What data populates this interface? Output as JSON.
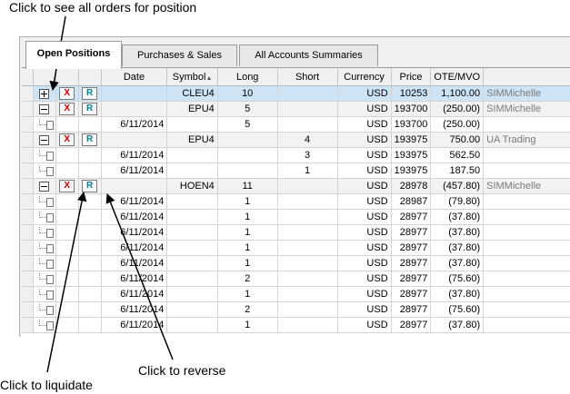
{
  "callouts": {
    "top": "Click to see all orders for position",
    "liquidate": "Click to liquidate",
    "reverse": "Click to reverse"
  },
  "tabs": [
    {
      "label": "Open Positions",
      "active": true
    },
    {
      "label": "Purchases & Sales",
      "active": false
    },
    {
      "label": "All Accounts Summaries",
      "active": false
    }
  ],
  "columns": {
    "date": "Date",
    "symbol": "Symbol",
    "long": "Long",
    "short": "Short",
    "currency": "Currency",
    "price": "Price",
    "ote": "OTE/MVO"
  },
  "buttons": {
    "liquidate": "X",
    "reverse": "R"
  },
  "rows": [
    {
      "kind": "parent",
      "expanded": false,
      "selected": true,
      "date": "",
      "symbol": "CLEU4",
      "long": "10",
      "short": "",
      "currency": "USD",
      "price": "10253",
      "ote": "1,100.00",
      "account": "SIMMichelle"
    },
    {
      "kind": "parent",
      "expanded": true,
      "selected": false,
      "date": "",
      "symbol": "EPU4",
      "long": "5",
      "short": "",
      "currency": "USD",
      "price": "193700",
      "ote": "(250.00)",
      "account": "SIMMichelle"
    },
    {
      "kind": "child",
      "date": "6/11/2014",
      "symbol": "",
      "long": "5",
      "short": "",
      "currency": "USD",
      "price": "193700",
      "ote": "(250.00)",
      "account": ""
    },
    {
      "kind": "parent",
      "expanded": true,
      "selected": false,
      "date": "",
      "symbol": "EPU4",
      "long": "",
      "short": "4",
      "currency": "USD",
      "price": "193975",
      "ote": "750.00",
      "account": "UA Trading"
    },
    {
      "kind": "child",
      "date": "6/11/2014",
      "symbol": "",
      "long": "",
      "short": "3",
      "currency": "USD",
      "price": "193975",
      "ote": "562.50",
      "account": ""
    },
    {
      "kind": "child",
      "date": "6/11/2014",
      "symbol": "",
      "long": "",
      "short": "1",
      "currency": "USD",
      "price": "193975",
      "ote": "187.50",
      "account": ""
    },
    {
      "kind": "parent",
      "expanded": true,
      "selected": false,
      "date": "",
      "symbol": "HOEN4",
      "long": "11",
      "short": "",
      "currency": "USD",
      "price": "28978",
      "ote": "(457.80)",
      "account": "SIMMichelle"
    },
    {
      "kind": "child",
      "date": "6/11/2014",
      "symbol": "",
      "long": "1",
      "short": "",
      "currency": "USD",
      "price": "28987",
      "ote": "(79.80)",
      "account": ""
    },
    {
      "kind": "child",
      "date": "6/11/2014",
      "symbol": "",
      "long": "1",
      "short": "",
      "currency": "USD",
      "price": "28977",
      "ote": "(37.80)",
      "account": ""
    },
    {
      "kind": "child",
      "date": "6/11/2014",
      "symbol": "",
      "long": "1",
      "short": "",
      "currency": "USD",
      "price": "28977",
      "ote": "(37.80)",
      "account": ""
    },
    {
      "kind": "child",
      "date": "6/11/2014",
      "symbol": "",
      "long": "1",
      "short": "",
      "currency": "USD",
      "price": "28977",
      "ote": "(37.80)",
      "account": ""
    },
    {
      "kind": "child",
      "date": "6/11/2014",
      "symbol": "",
      "long": "1",
      "short": "",
      "currency": "USD",
      "price": "28977",
      "ote": "(37.80)",
      "account": ""
    },
    {
      "kind": "child",
      "date": "6/11/2014",
      "symbol": "",
      "long": "2",
      "short": "",
      "currency": "USD",
      "price": "28977",
      "ote": "(75.60)",
      "account": ""
    },
    {
      "kind": "child",
      "date": "6/11/2014",
      "symbol": "",
      "long": "1",
      "short": "",
      "currency": "USD",
      "price": "28977",
      "ote": "(37.80)",
      "account": ""
    },
    {
      "kind": "child",
      "date": "6/11/2014",
      "symbol": "",
      "long": "2",
      "short": "",
      "currency": "USD",
      "price": "28977",
      "ote": "(75.60)",
      "account": ""
    },
    {
      "kind": "child",
      "date": "6/11/2014",
      "symbol": "",
      "long": "1",
      "short": "",
      "currency": "USD",
      "price": "28977",
      "ote": "(37.80)",
      "account": ""
    }
  ]
}
